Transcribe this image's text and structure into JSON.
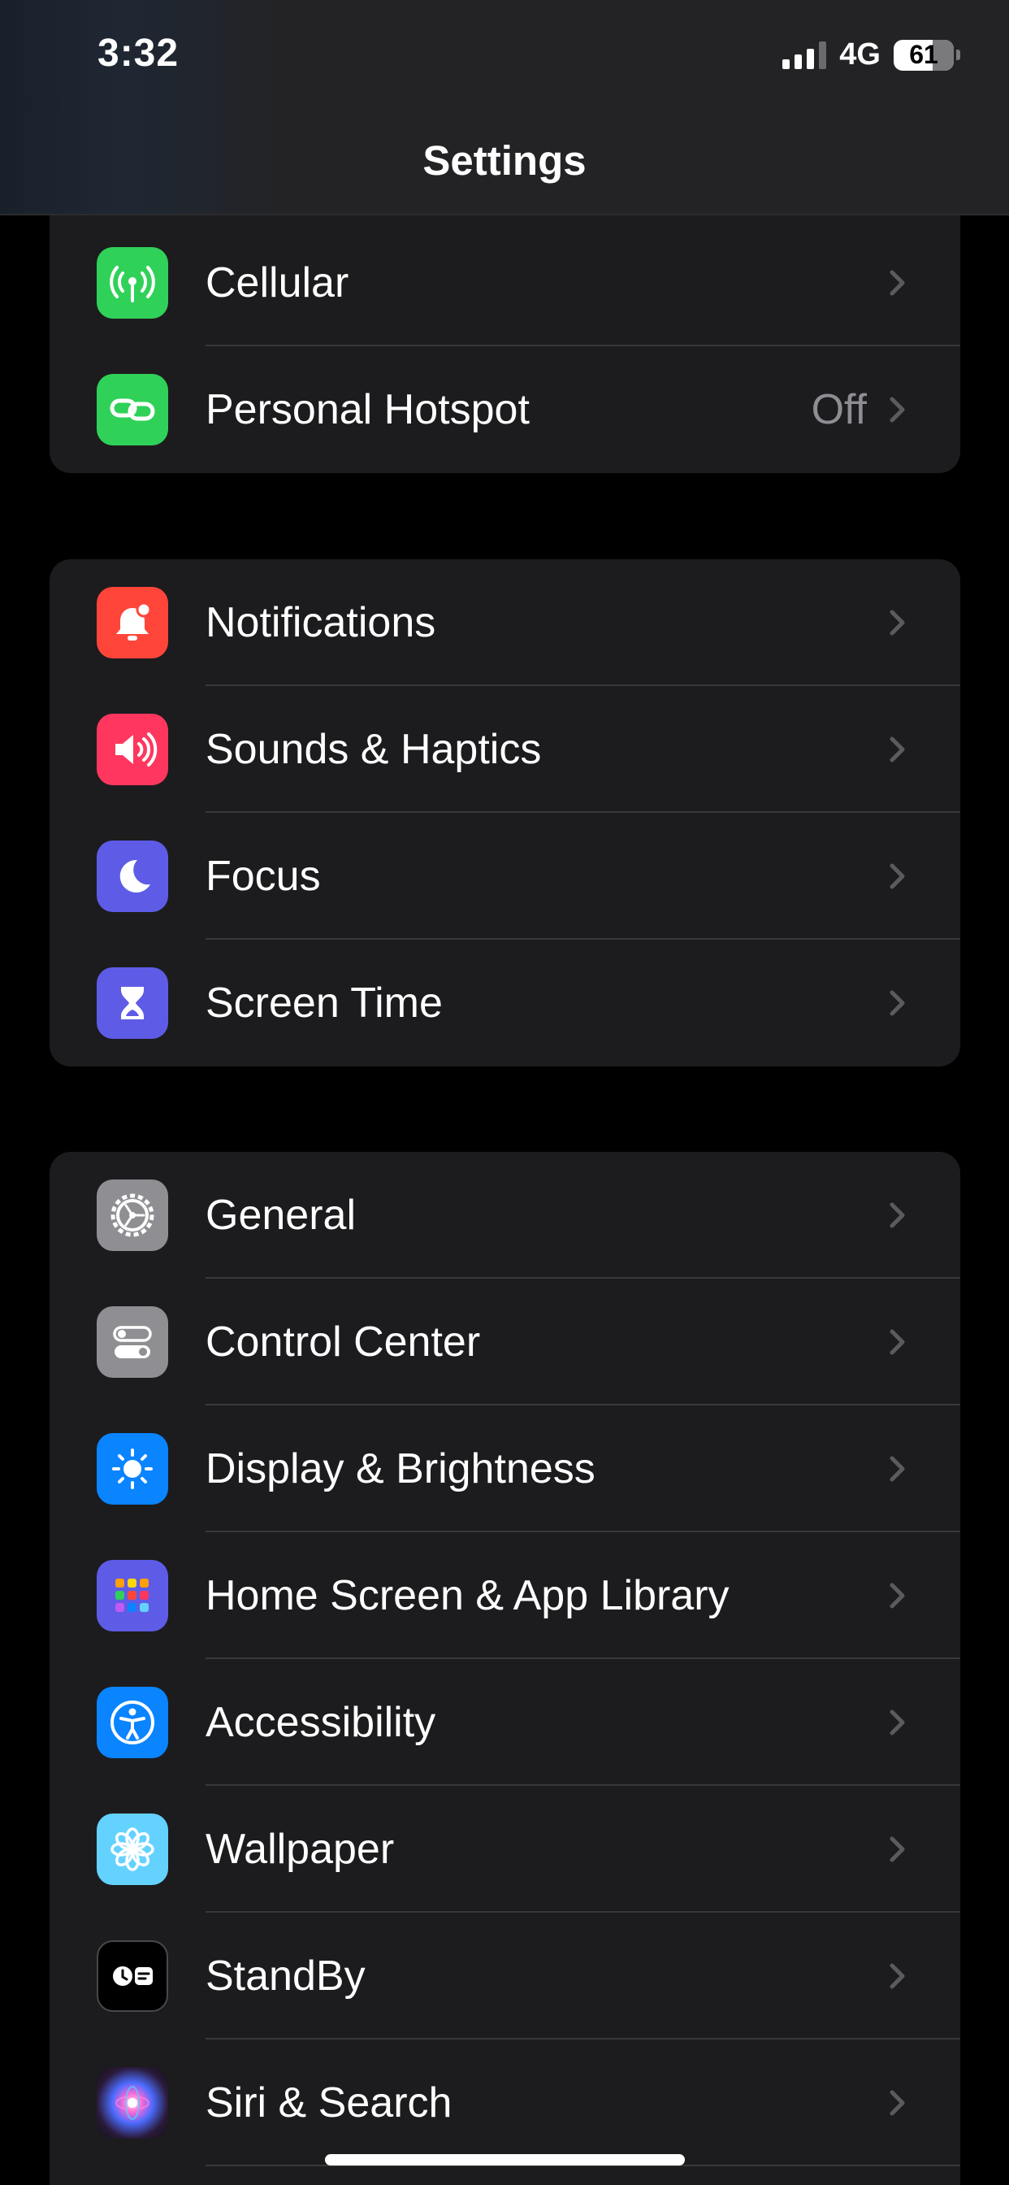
{
  "status_bar": {
    "time": "3:32",
    "network": "4G",
    "battery": "61"
  },
  "nav": {
    "title": "Settings"
  },
  "groups": [
    {
      "items": [
        {
          "label": "Cellular",
          "value": "",
          "icon": "antenna-icon",
          "color": "#30d158"
        },
        {
          "label": "Personal Hotspot",
          "value": "Off",
          "icon": "hotspot-link-icon",
          "color": "#30d158"
        }
      ]
    },
    {
      "items": [
        {
          "label": "Notifications",
          "value": "",
          "icon": "bell-icon",
          "color": "#ff453a"
        },
        {
          "label": "Sounds & Haptics",
          "value": "",
          "icon": "speaker-icon",
          "color": "#ff375f"
        },
        {
          "label": "Focus",
          "value": "",
          "icon": "moon-icon",
          "color": "#5e5ce6"
        },
        {
          "label": "Screen Time",
          "value": "",
          "icon": "hourglass-icon",
          "color": "#5e5ce6"
        }
      ]
    },
    {
      "items": [
        {
          "label": "General",
          "value": "",
          "icon": "gear-icon",
          "color": "#8e8e93"
        },
        {
          "label": "Control Center",
          "value": "",
          "icon": "toggles-icon",
          "color": "#8e8e93"
        },
        {
          "label": "Display & Brightness",
          "value": "",
          "icon": "sun-icon",
          "color": "#0a84ff"
        },
        {
          "label": "Home Screen & App Library",
          "value": "",
          "icon": "app-grid-icon",
          "color": "#5e5ce6"
        },
        {
          "label": "Accessibility",
          "value": "",
          "icon": "accessibility-icon",
          "color": "#0a84ff"
        },
        {
          "label": "Wallpaper",
          "value": "",
          "icon": "flower-icon",
          "color": "#64d2ff"
        },
        {
          "label": "StandBy",
          "value": "",
          "icon": "standby-icon",
          "color": "#000000"
        },
        {
          "label": "Siri & Search",
          "value": "",
          "icon": "siri-icon",
          "color": "#1c1c1e"
        }
      ]
    }
  ]
}
